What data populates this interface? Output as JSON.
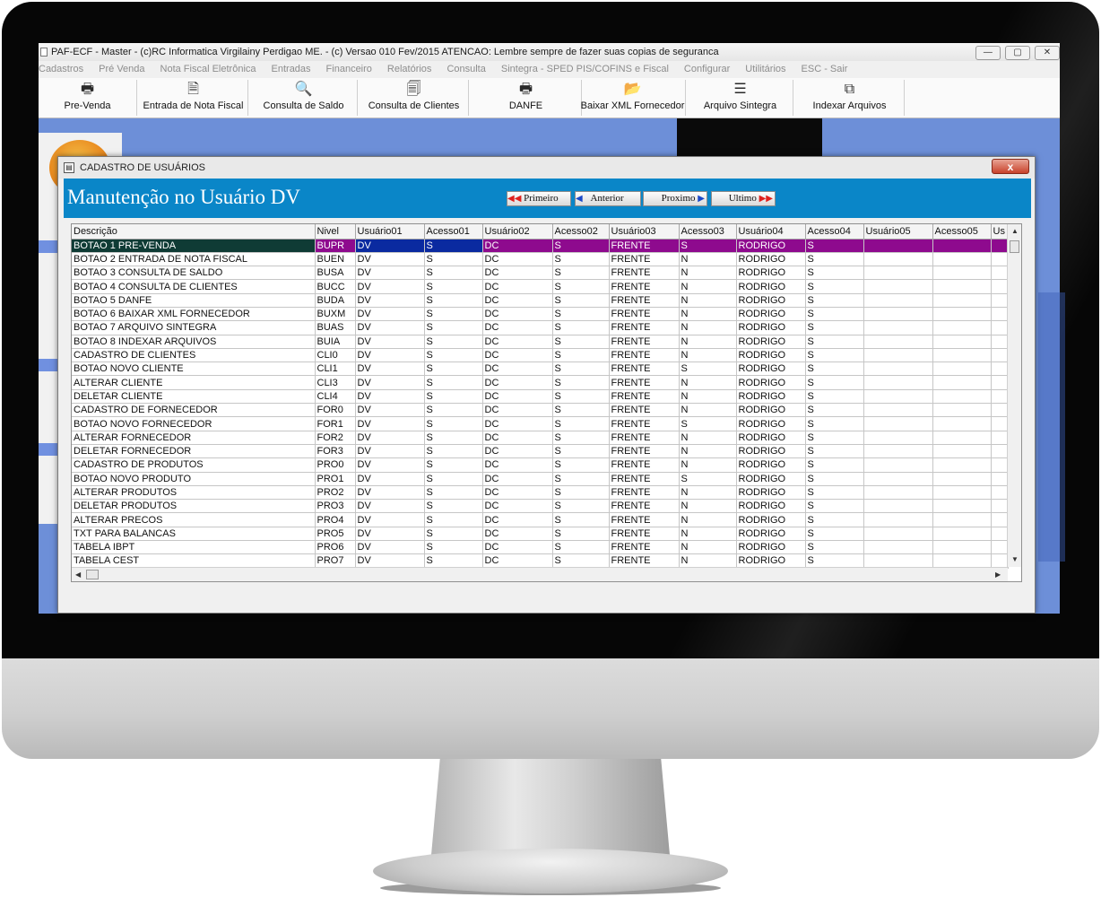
{
  "window": {
    "title": "PAF-ECF - Master - (c)RC Informatica Virgilainy Perdigao ME.  - (c) Versao 010 Fev/2015 ATENCAO: Lembre sempre de fazer suas copias de seguranca",
    "min": "—",
    "max": "▢",
    "close": "✕"
  },
  "menu": [
    "Cadastros",
    "Pré Venda",
    "Nota Fiscal Eletrônica",
    "Entradas",
    "Financeiro",
    "Relatórios",
    "Consulta",
    "Sintegra - SPED PIS/COFINS e Fiscal",
    "Configurar",
    "Utilitários",
    "ESC - Sair"
  ],
  "toolbar": [
    {
      "label": "Pre-Venda",
      "icon": "printer-icon"
    },
    {
      "label": "Entrada de Nota Fiscal",
      "icon": "document-icon"
    },
    {
      "label": "Consulta de Saldo",
      "icon": "magnifier-icon"
    },
    {
      "label": "Consulta de Clientes",
      "icon": "document-search-icon"
    },
    {
      "label": "DANFE",
      "icon": "printer-icon"
    },
    {
      "label": "Baixar XML Fornecedor",
      "icon": "folder-open-icon"
    },
    {
      "label": "Arquivo Sintegra",
      "icon": "list-icon"
    },
    {
      "label": "Indexar Arquivos",
      "icon": "copy-down-icon"
    }
  ],
  "dialog": {
    "title": "CADASTRO DE USUÁRIOS",
    "close": "x",
    "heading": "Manutenção no Usuário DV",
    "nav": {
      "first": "Primeiro",
      "prev": "Anterior",
      "next": "Proximo",
      "last": "Ultimo"
    }
  },
  "grid": {
    "columns": [
      "Descrição",
      "Nivel",
      "Usuário01",
      "Acesso01",
      "Usuário02",
      "Acesso02",
      "Usuário03",
      "Acesso03",
      "Usuário04",
      "Acesso04",
      "Usuário05",
      "Acesso05",
      "Us"
    ],
    "rows": [
      [
        "BOTAO 1 PRE-VENDA",
        "BUPR",
        "DV",
        "S",
        "DC",
        "S",
        "FRENTE",
        "S",
        "RODRIGO",
        "S",
        "",
        "",
        ""
      ],
      [
        "BOTAO 2 ENTRADA DE NOTA FISCAL",
        "BUEN",
        "DV",
        "S",
        "DC",
        "S",
        "FRENTE",
        "N",
        "RODRIGO",
        "S",
        "",
        "",
        ""
      ],
      [
        "BOTAO 3 CONSULTA DE SALDO",
        "BUSA",
        "DV",
        "S",
        "DC",
        "S",
        "FRENTE",
        "N",
        "RODRIGO",
        "S",
        "",
        "",
        ""
      ],
      [
        "BOTAO 4 CONSULTA DE CLIENTES",
        "BUCC",
        "DV",
        "S",
        "DC",
        "S",
        "FRENTE",
        "N",
        "RODRIGO",
        "S",
        "",
        "",
        ""
      ],
      [
        "BOTAO 5 DANFE",
        "BUDA",
        "DV",
        "S",
        "DC",
        "S",
        "FRENTE",
        "N",
        "RODRIGO",
        "S",
        "",
        "",
        ""
      ],
      [
        "BOTAO 6 BAIXAR XML FORNECEDOR",
        "BUXM",
        "DV",
        "S",
        "DC",
        "S",
        "FRENTE",
        "N",
        "RODRIGO",
        "S",
        "",
        "",
        ""
      ],
      [
        "BOTAO 7 ARQUIVO SINTEGRA",
        "BUAS",
        "DV",
        "S",
        "DC",
        "S",
        "FRENTE",
        "N",
        "RODRIGO",
        "S",
        "",
        "",
        ""
      ],
      [
        "BOTAO 8 INDEXAR ARQUIVOS",
        "BUIA",
        "DV",
        "S",
        "DC",
        "S",
        "FRENTE",
        "N",
        "RODRIGO",
        "S",
        "",
        "",
        ""
      ],
      [
        "CADASTRO DE CLIENTES",
        "CLI0",
        "DV",
        "S",
        "DC",
        "S",
        "FRENTE",
        "N",
        "RODRIGO",
        "S",
        "",
        "",
        ""
      ],
      [
        "BOTAO NOVO CLIENTE",
        "CLI1",
        "DV",
        "S",
        "DC",
        "S",
        "FRENTE",
        "S",
        "RODRIGO",
        "S",
        "",
        "",
        ""
      ],
      [
        "ALTERAR CLIENTE",
        "CLI3",
        "DV",
        "S",
        "DC",
        "S",
        "FRENTE",
        "N",
        "RODRIGO",
        "S",
        "",
        "",
        ""
      ],
      [
        "DELETAR CLIENTE",
        "CLI4",
        "DV",
        "S",
        "DC",
        "S",
        "FRENTE",
        "N",
        "RODRIGO",
        "S",
        "",
        "",
        ""
      ],
      [
        "CADASTRO DE FORNECEDOR",
        "FOR0",
        "DV",
        "S",
        "DC",
        "S",
        "FRENTE",
        "N",
        "RODRIGO",
        "S",
        "",
        "",
        ""
      ],
      [
        "BOTAO NOVO FORNECEDOR",
        "FOR1",
        "DV",
        "S",
        "DC",
        "S",
        "FRENTE",
        "S",
        "RODRIGO",
        "S",
        "",
        "",
        ""
      ],
      [
        "ALTERAR FORNECEDOR",
        "FOR2",
        "DV",
        "S",
        "DC",
        "S",
        "FRENTE",
        "N",
        "RODRIGO",
        "S",
        "",
        "",
        ""
      ],
      [
        "DELETAR FORNECEDOR",
        "FOR3",
        "DV",
        "S",
        "DC",
        "S",
        "FRENTE",
        "N",
        "RODRIGO",
        "S",
        "",
        "",
        ""
      ],
      [
        "CADASTRO DE PRODUTOS",
        "PRO0",
        "DV",
        "S",
        "DC",
        "S",
        "FRENTE",
        "N",
        "RODRIGO",
        "S",
        "",
        "",
        ""
      ],
      [
        "BOTAO NOVO PRODUTO",
        "PRO1",
        "DV",
        "S",
        "DC",
        "S",
        "FRENTE",
        "S",
        "RODRIGO",
        "S",
        "",
        "",
        ""
      ],
      [
        "ALTERAR PRODUTOS",
        "PRO2",
        "DV",
        "S",
        "DC",
        "S",
        "FRENTE",
        "N",
        "RODRIGO",
        "S",
        "",
        "",
        ""
      ],
      [
        "DELETAR PRODUTOS",
        "PRO3",
        "DV",
        "S",
        "DC",
        "S",
        "FRENTE",
        "N",
        "RODRIGO",
        "S",
        "",
        "",
        ""
      ],
      [
        "ALTERAR PRECOS",
        "PRO4",
        "DV",
        "S",
        "DC",
        "S",
        "FRENTE",
        "N",
        "RODRIGO",
        "S",
        "",
        "",
        ""
      ],
      [
        "TXT PARA BALANCAS",
        "PRO5",
        "DV",
        "S",
        "DC",
        "S",
        "FRENTE",
        "N",
        "RODRIGO",
        "S",
        "",
        "",
        ""
      ],
      [
        "TABELA IBPT",
        "PRO6",
        "DV",
        "S",
        "DC",
        "S",
        "FRENTE",
        "N",
        "RODRIGO",
        "S",
        "",
        "",
        ""
      ],
      [
        "TABELA CEST",
        "PRO7",
        "DV",
        "S",
        "DC",
        "S",
        "FRENTE",
        "N",
        "RODRIGO",
        "S",
        "",
        "",
        ""
      ]
    ],
    "red_title_rows": [
      "CADASTRO DE CLIENTES",
      "CADASTRO DE FORNECEDOR",
      "CADASTRO DE PRODUTOS"
    ],
    "selected_row": "BOTAO 1 PRE-VENDA"
  },
  "colors": {
    "desktop": "#6d8fd8",
    "banner": "#0a86c8",
    "selection": "#8e0a8e",
    "user_text": "#dd1e1e",
    "access_text": "#2f9a2f"
  }
}
